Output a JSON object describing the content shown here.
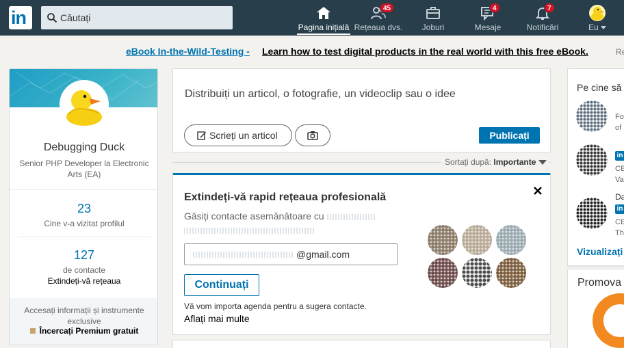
{
  "nav": {
    "logo": "in",
    "search_placeholder": "Căutați",
    "items": [
      {
        "label": "Pagina inițială",
        "icon": "home-icon",
        "active": true,
        "badge": ""
      },
      {
        "label": "Rețeaua dvs.",
        "icon": "network-icon",
        "active": false,
        "badge": "45"
      },
      {
        "label": "Joburi",
        "icon": "jobs-icon",
        "active": false,
        "badge": ""
      },
      {
        "label": "Mesaje",
        "icon": "messages-icon",
        "active": false,
        "badge": "4"
      },
      {
        "label": "Notificări",
        "icon": "bell-icon",
        "active": false,
        "badge": "7"
      },
      {
        "label": "Eu",
        "icon": "avatar",
        "active": false,
        "badge": ""
      }
    ]
  },
  "ad": {
    "link": "eBook In-the-Wild-Testing -",
    "text": "Learn how to test digital products in the real world with this free eBook.",
    "tail": "Re"
  },
  "profile": {
    "name": "Debugging Duck",
    "title": "Senior PHP Developer la Electronic Arts (EA)",
    "views_count": "23",
    "views_label": "Cine v-a vizitat profilul",
    "connections_count": "127",
    "connections_label": "de contacte",
    "connections_action": "Extindeți-vă rețeaua",
    "premium_text": "Accesați informații și instrumente exclusive",
    "premium_link": "Încercați Premium gratuit"
  },
  "share": {
    "prompt": "Distribuiți un articol, o fotografie, un videoclip sau o idee",
    "write_article": "Scrieți un articol",
    "publish": "Publicați"
  },
  "sort": {
    "label": "Sortați după:",
    "value": "Importante"
  },
  "network_card": {
    "title": "Extindeți-vă rapid rețeaua profesională",
    "desc": "Găsiți contacte asemănătoare cu",
    "email_suffix": "@gmail.com",
    "continue": "Continuați",
    "note": "Vă vom importa agenda pentru a sugera contacte.",
    "more": "Aflați mai multe"
  },
  "rail": {
    "title": "Pe cine să",
    "people": [
      {
        "line1": "Fo",
        "line2": "of",
        "li": false
      },
      {
        "line1": "CE",
        "line2": "Va",
        "li": true
      },
      {
        "name": "Da",
        "line1": "CE",
        "line2": "Th",
        "li": true
      }
    ],
    "li_badge": "in",
    "more": "Vizualizați",
    "promo": "Promova"
  },
  "colors": {
    "nav_bg": "#283e4a",
    "brand": "#0073b1",
    "badge": "#d11124",
    "promo_orange": "#f28a21"
  }
}
